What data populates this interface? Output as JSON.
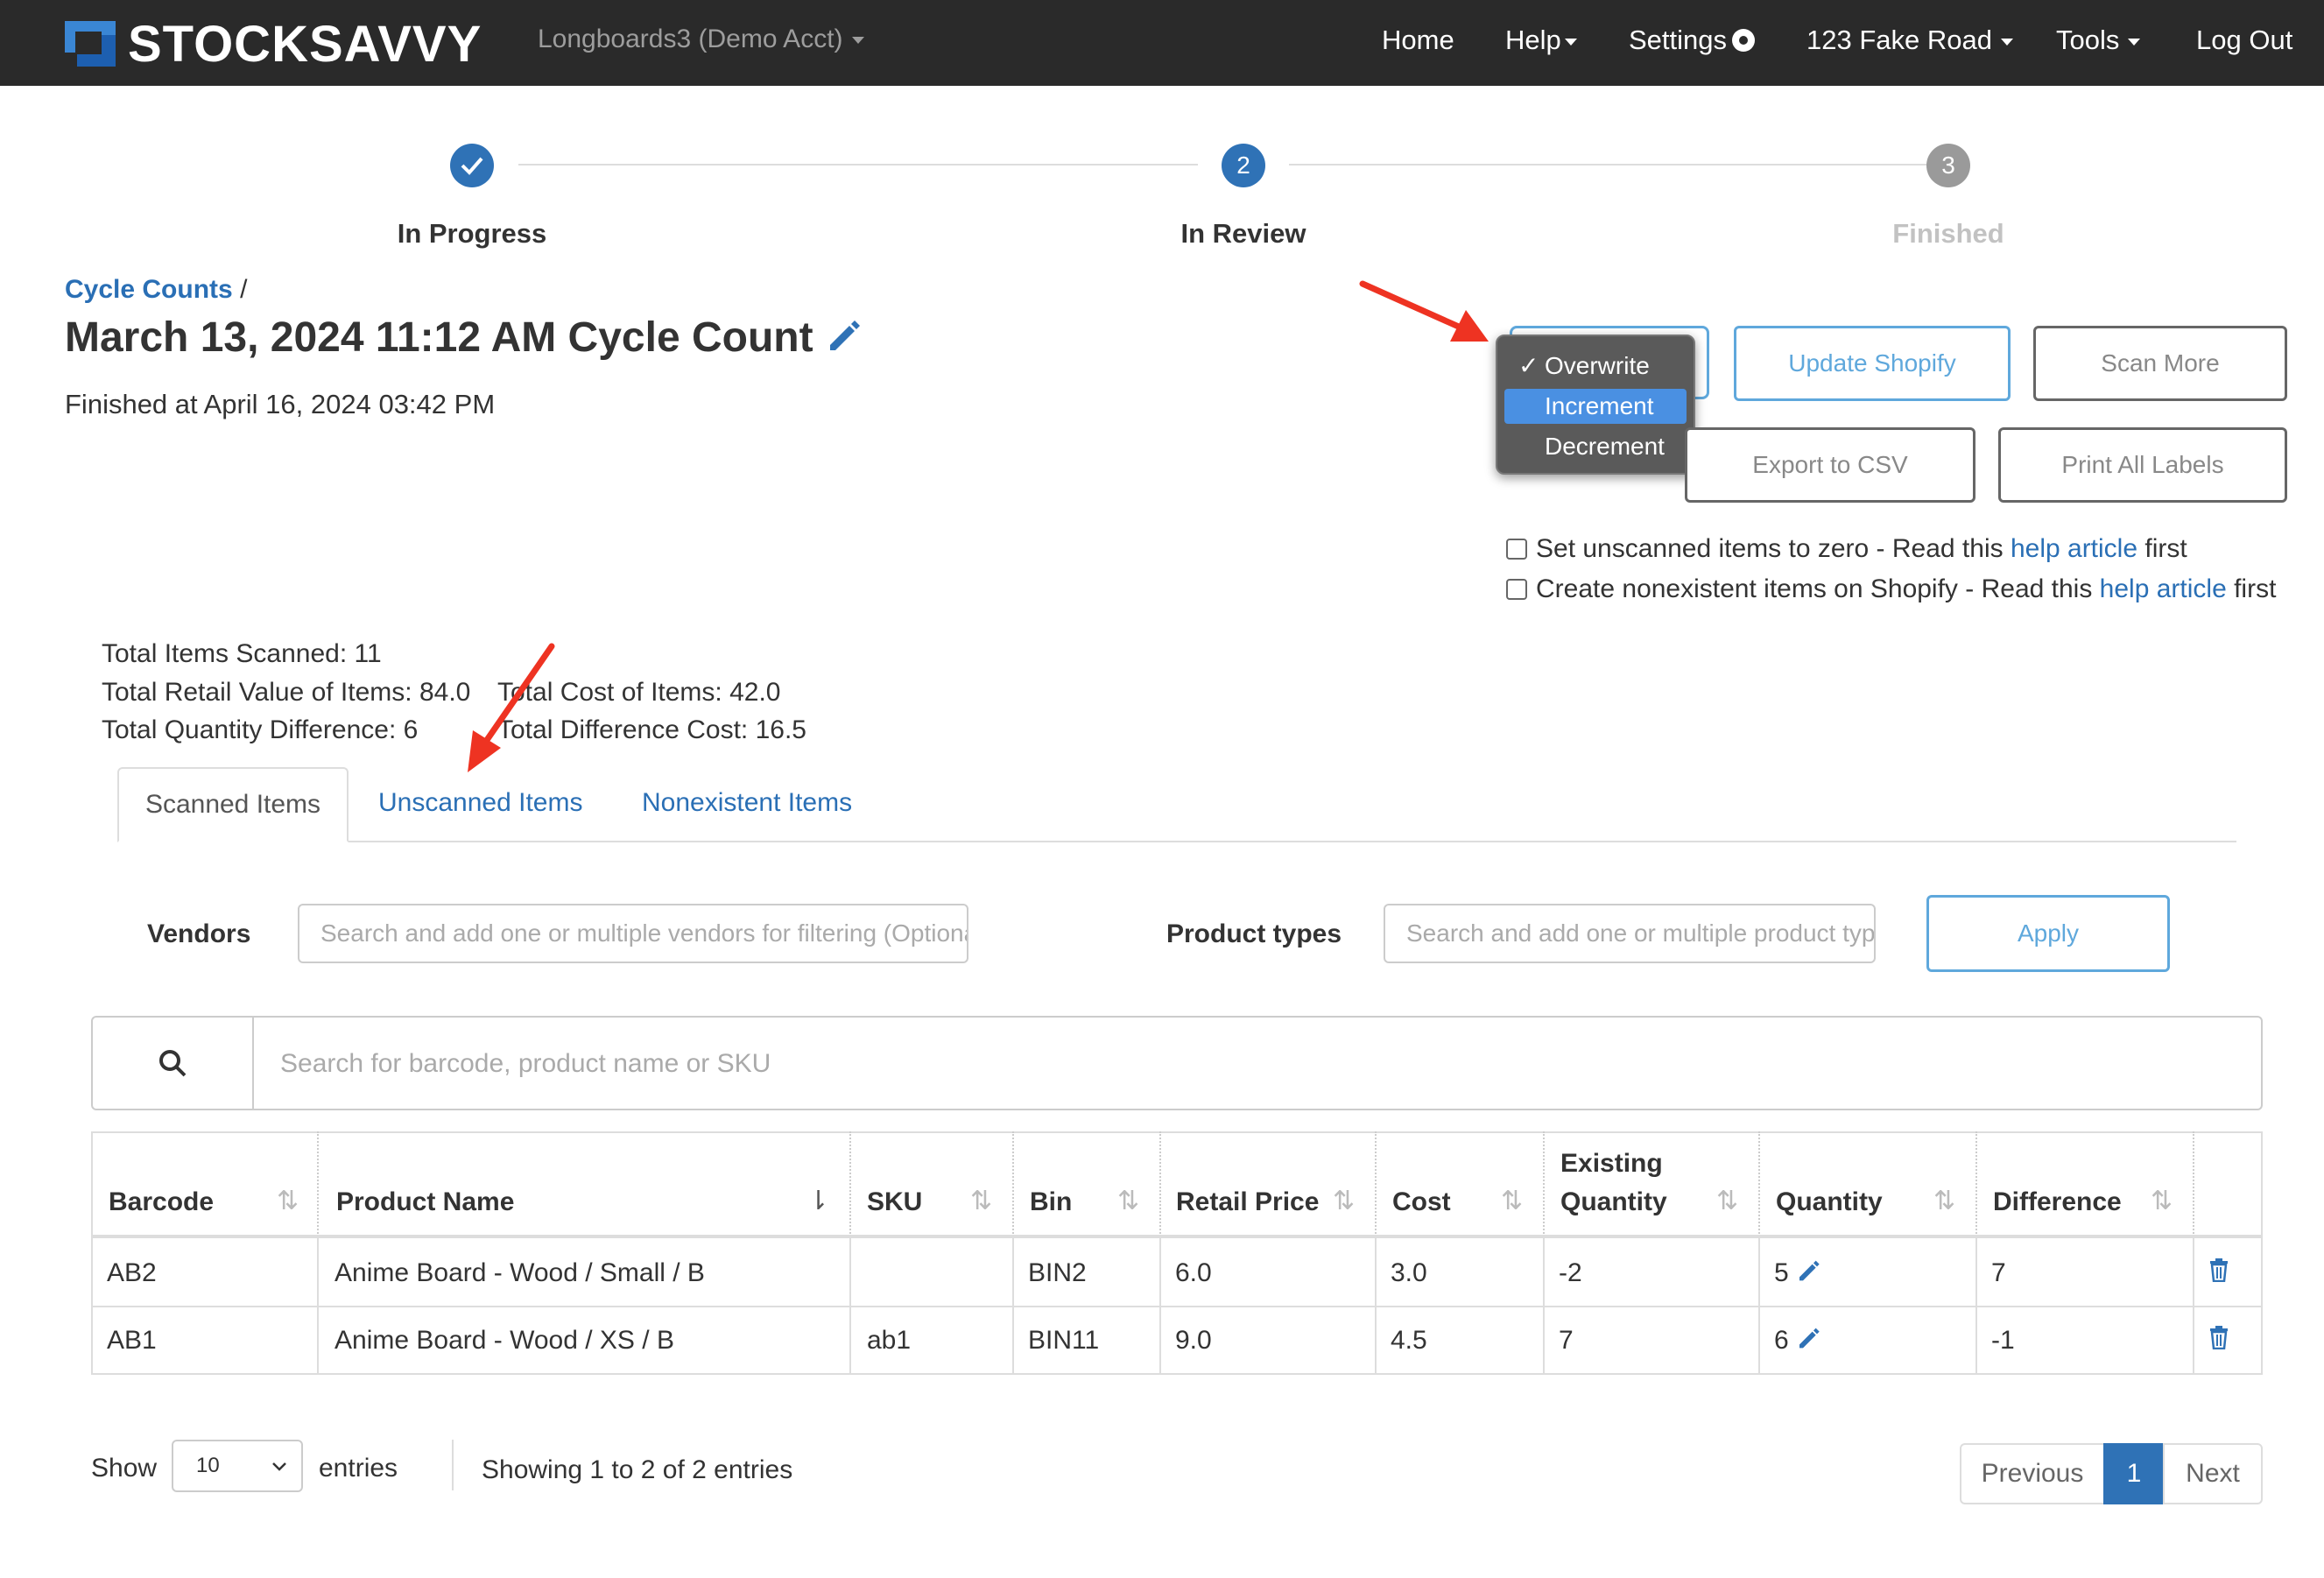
{
  "navbar": {
    "logo_text": "STOCKSAVVY",
    "account": "Longboards3 (Demo Acct)",
    "links": {
      "home": "Home",
      "help": "Help",
      "settings": "Settings",
      "location": "123 Fake Road",
      "tools": "Tools",
      "logout": "Log Out"
    }
  },
  "stepper": {
    "steps": [
      {
        "number": "",
        "label": "In Progress",
        "state": "done"
      },
      {
        "number": "2",
        "label": "In Review",
        "state": "current"
      },
      {
        "number": "3",
        "label": "Finished",
        "state": "pending"
      }
    ]
  },
  "header": {
    "breadcrumb_link": "Cycle Counts",
    "breadcrumb_sep": "/",
    "title": "March 13, 2024 11:12 AM Cycle Count",
    "finished_at": "Finished at April 16, 2024 03:42 PM"
  },
  "mode_menu": {
    "options": [
      "Overwrite",
      "Increment",
      "Decrement"
    ],
    "checked": "Overwrite",
    "highlighted": "Increment",
    "check_mark": "✓"
  },
  "actions": {
    "update_shopify": "Update Shopify",
    "scan_more": "Scan More",
    "export_csv": "Export to CSV",
    "print_labels": "Print All Labels"
  },
  "options": {
    "zero_prefix": "Set unscanned items to zero - Read this ",
    "zero_link": "help article",
    "zero_suffix": " first",
    "create_prefix": "Create nonexistent items on Shopify - Read this ",
    "create_link": "help article",
    "create_suffix": " first"
  },
  "stats": {
    "total_scanned": "Total Items Scanned: 11",
    "total_retail": "Total Retail Value of Items: 84.0",
    "total_cost": "Total Cost of Items: 42.0",
    "total_qty_diff": "Total Quantity Difference: 6",
    "total_diff_cost": "Total Difference Cost: 16.5"
  },
  "tabs": {
    "scanned": "Scanned Items",
    "unscanned": "Unscanned Items",
    "nonexistent": "Nonexistent Items"
  },
  "filters": {
    "vendors_label": "Vendors",
    "vendors_placeholder": "Search and add one or multiple vendors for filtering (Optional)",
    "types_label": "Product types",
    "types_placeholder": "Search and add one or multiple product types",
    "apply": "Apply"
  },
  "search": {
    "placeholder": "Search for barcode, product name or SKU"
  },
  "table": {
    "headers": {
      "barcode": "Barcode",
      "product_name": "Product Name",
      "sku": "SKU",
      "bin": "Bin",
      "retail_price": "Retail Price",
      "cost": "Cost",
      "existing_1": "Existing",
      "existing_2": "Quantity",
      "quantity": "Quantity",
      "difference": "Difference"
    },
    "rows": [
      {
        "barcode": "AB2",
        "product_name": "Anime Board - Wood / Small / B",
        "sku": "",
        "bin": "BIN2",
        "retail_price": "6.0",
        "cost": "3.0",
        "existing": "-2",
        "quantity": "5",
        "difference": "7"
      },
      {
        "barcode": "AB1",
        "product_name": "Anime Board - Wood / XS / B",
        "sku": "ab1",
        "bin": "BIN11",
        "retail_price": "9.0",
        "cost": "4.5",
        "existing": "7",
        "quantity": "6",
        "difference": "-1"
      }
    ]
  },
  "footer": {
    "show": "Show",
    "page_size": "10",
    "entries": "entries",
    "summary": "Showing 1 to 2 of 2 entries",
    "previous": "Previous",
    "page": "1",
    "next": "Next"
  },
  "colors": {
    "navbar": "#2a2a2a",
    "link": "#2a6fb5",
    "accent": "#5fa8dc",
    "arrow": "#ee3322"
  }
}
